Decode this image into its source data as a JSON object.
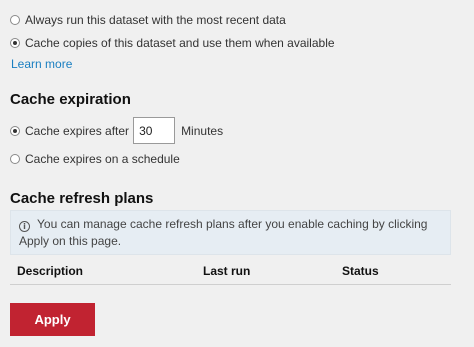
{
  "refresh_options": [
    {
      "label": "Always run this dataset with the most recent data",
      "checked": false
    },
    {
      "label": "Cache copies of this dataset and use them when available",
      "checked": true
    }
  ],
  "learn_more_link": "Learn more",
  "cache_expiration": {
    "heading": "Cache expiration",
    "expires_after_label": "Cache expires after",
    "expires_after_value": "30",
    "unit_label": "Minutes",
    "schedule_label": "Cache expires on a schedule",
    "selected": "expires_after"
  },
  "cache_refresh_plans": {
    "heading": "Cache refresh plans",
    "info_icon": "info-circle-icon",
    "info_text": "You can manage cache refresh plans after you enable caching by clicking Apply on this page.",
    "columns": [
      "Description",
      "Last run",
      "Status"
    ]
  },
  "apply_button": {
    "label": "Apply",
    "color": "#c12331"
  }
}
